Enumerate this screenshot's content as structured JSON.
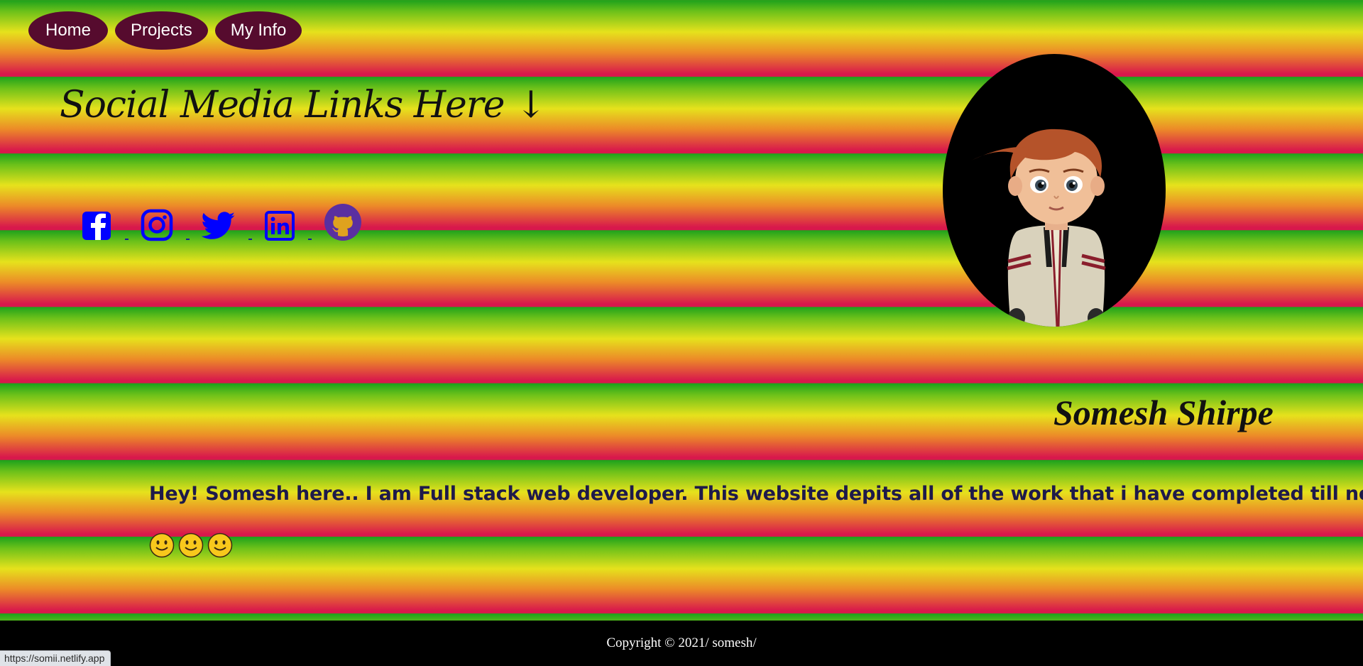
{
  "nav": {
    "items": [
      {
        "label": "Home"
      },
      {
        "label": "Projects"
      },
      {
        "label": "My Info"
      }
    ]
  },
  "social": {
    "heading": "Social Media Links Here ↓",
    "links": [
      {
        "icon": "facebook-icon"
      },
      {
        "icon": "instagram-icon"
      },
      {
        "icon": "twitter-icon"
      },
      {
        "icon": "linkedin-icon"
      },
      {
        "icon": "github-icon"
      }
    ]
  },
  "profile": {
    "name": "Somesh Shirpe",
    "bio": "Hey! Somesh here.. I am Full stack web developer. This website depits all of the work that i have completed till now..",
    "smileys": "🙂🙂🙂"
  },
  "footer": {
    "copyright": "Copyright © 2021/ somesh/"
  },
  "status_bar": {
    "url": "https://somii.netlify.app"
  },
  "colors": {
    "nav_button": "#560b2e",
    "icon_blue": "#0000ff",
    "github_purple": "#5a2fa0",
    "footer_bg": "#000000"
  }
}
